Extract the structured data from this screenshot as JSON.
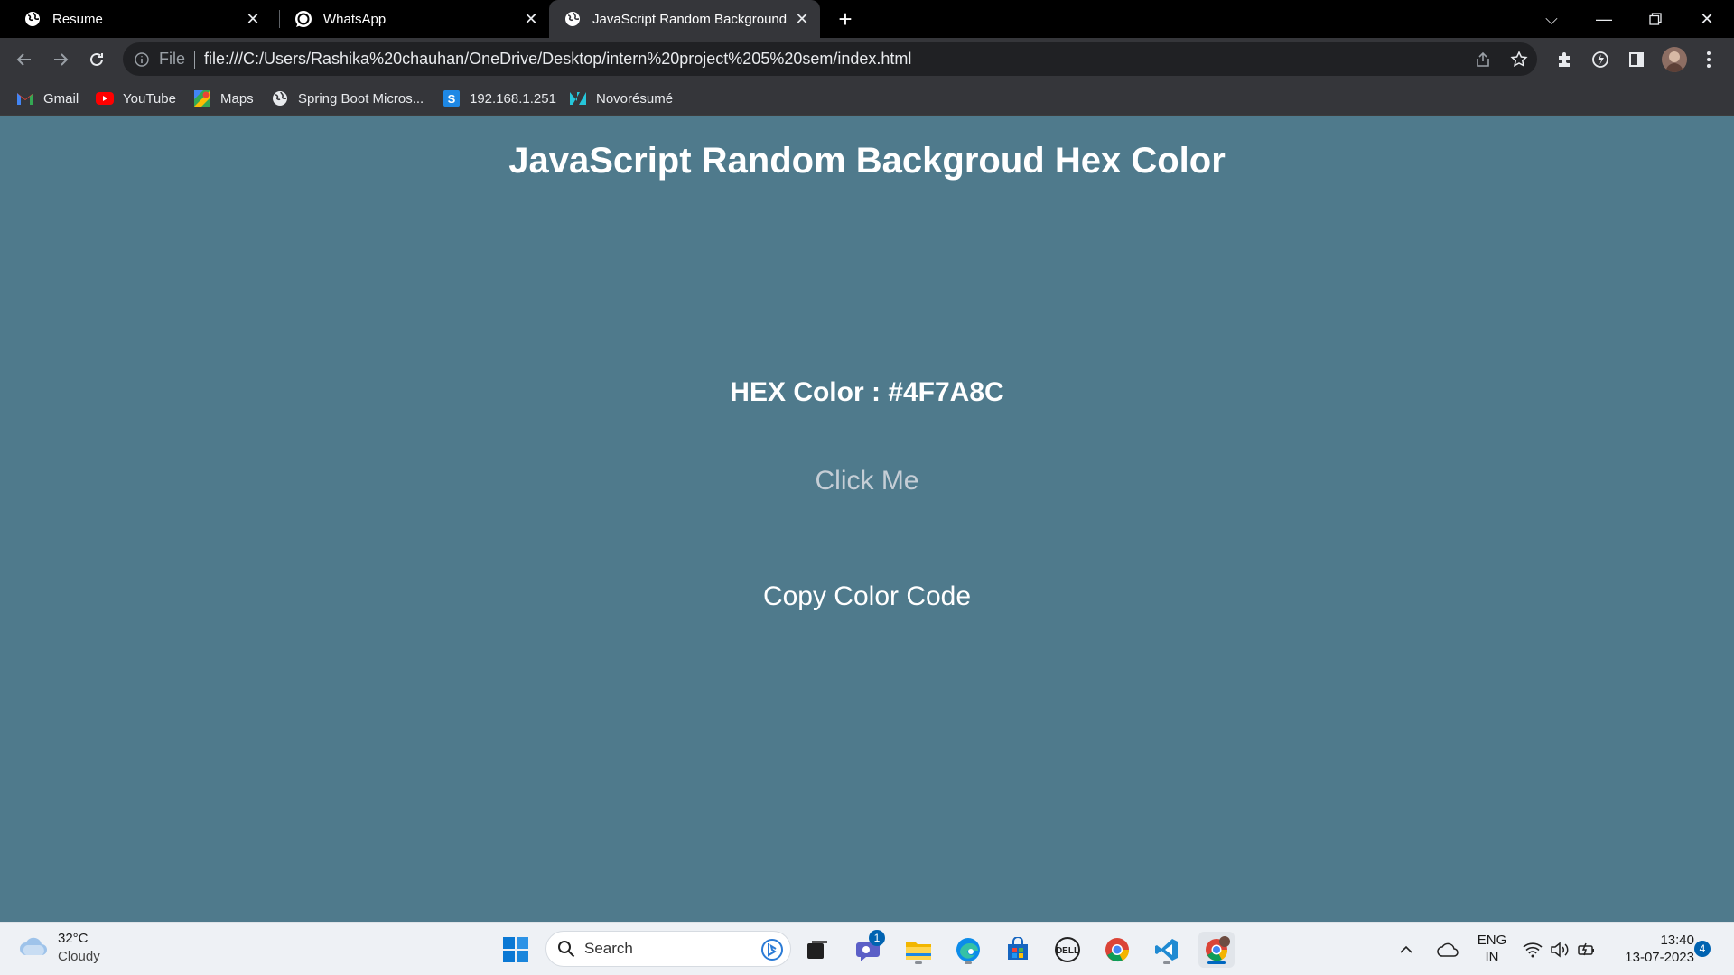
{
  "browser": {
    "tabs": [
      {
        "label": "Resume",
        "icon": "globe-icon"
      },
      {
        "label": "WhatsApp",
        "icon": "whatsapp-icon"
      },
      {
        "label": "JavaScript Random Background H",
        "icon": "globe-icon"
      }
    ],
    "address": {
      "scheme_label": "File",
      "url": "file:///C:/Users/Rashika%20chauhan/OneDrive/Desktop/intern%20project%205%20sem/index.html"
    },
    "bookmarks": [
      {
        "label": "Gmail",
        "icon": "gmail-icon"
      },
      {
        "label": "YouTube",
        "icon": "youtube-icon"
      },
      {
        "label": "Maps",
        "icon": "maps-icon"
      },
      {
        "label": "Spring Boot Micros...",
        "icon": "globe-icon"
      },
      {
        "label": "192.168.1.251",
        "icon": "s-icon"
      },
      {
        "label": "Novorésumé",
        "icon": "novoresume-icon"
      }
    ]
  },
  "page": {
    "background_color": "#4F7A8C",
    "heading": "JavaScript Random Backgroud Hex Color",
    "hex_label": "HEX Color : #4F7A8C",
    "click_button": "Click Me",
    "copy_button": "Copy Color Code"
  },
  "taskbar": {
    "weather": {
      "temp": "32°C",
      "condition": "Cloudy"
    },
    "search_placeholder": "Search",
    "teams_badge": "1",
    "language": {
      "line1": "ENG",
      "line2": "IN"
    },
    "time": "13:40",
    "date": "13-07-2023",
    "notification_count": "4"
  }
}
